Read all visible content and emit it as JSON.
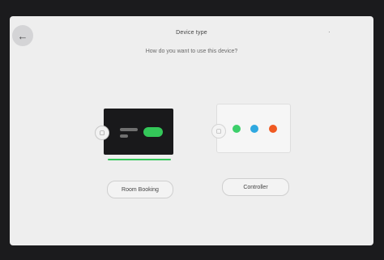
{
  "header": {
    "title": "Device type",
    "back_icon": "←",
    "more_icon": "·"
  },
  "question": "How do you want to use this device?",
  "options": [
    {
      "label": "Room Booking",
      "selected": true,
      "camera_icon": "▢"
    },
    {
      "label": "Controller",
      "selected": false,
      "camera_icon": "▢"
    }
  ],
  "colors": {
    "accent_green": "#34c759",
    "dot_green": "#3ccf6a",
    "dot_blue": "#2fa8e0",
    "dot_orange": "#f05a22"
  }
}
